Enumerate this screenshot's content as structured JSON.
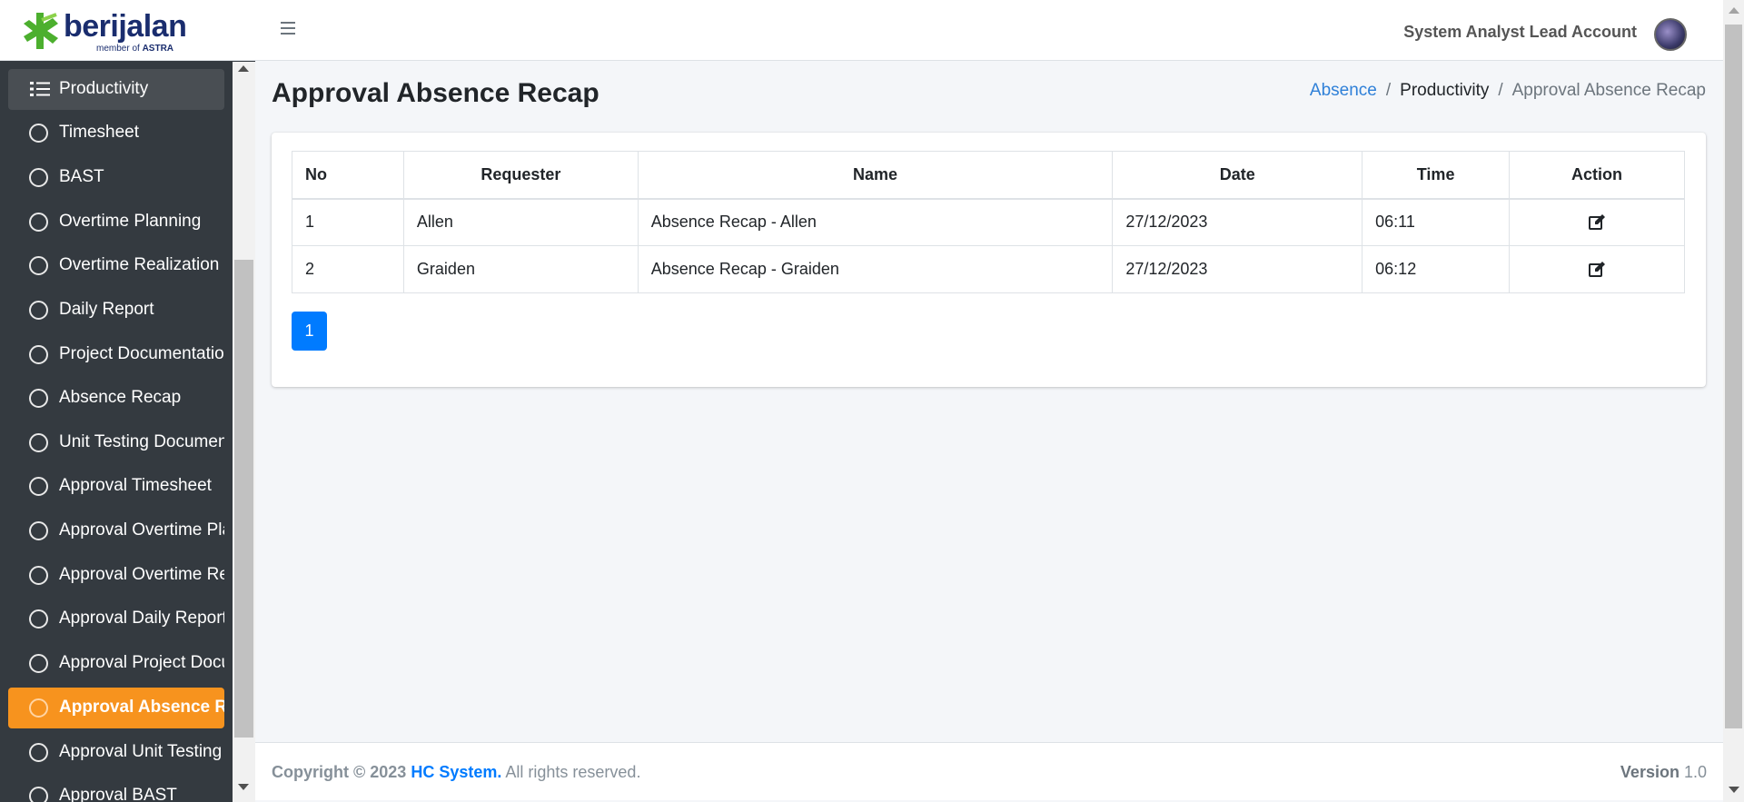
{
  "brand": {
    "name": "berijalan",
    "tagline_prefix": "member of",
    "tagline_bold": "ASTRA"
  },
  "sidebar": {
    "header_item": {
      "label": "Productivity",
      "icon": "list-icon"
    },
    "items": [
      {
        "label": "Timesheet"
      },
      {
        "label": "BAST"
      },
      {
        "label": "Overtime Planning"
      },
      {
        "label": "Overtime Realization"
      },
      {
        "label": "Daily Report"
      },
      {
        "label": "Project Documentation"
      },
      {
        "label": "Absence Recap"
      },
      {
        "label": "Unit Testing Document"
      },
      {
        "label": "Approval Timesheet"
      },
      {
        "label": "Approval Overtime Planning"
      },
      {
        "label": "Approval Overtime Realization"
      },
      {
        "label": "Approval Daily Report"
      },
      {
        "label": "Approval Project Documentation"
      },
      {
        "label": "Approval Absence Recap",
        "active": true
      },
      {
        "label": "Approval Unit Testing Document"
      },
      {
        "label": "Approval BAST"
      }
    ],
    "active_color": "#f7931e"
  },
  "topbar": {
    "user_name": "System Analyst Lead Account"
  },
  "page": {
    "title": "Approval Absence Recap",
    "breadcrumb": {
      "first": "Absence",
      "second": "Productivity",
      "third": "Approval Absence Recap"
    }
  },
  "table": {
    "headers": {
      "no": "No",
      "requester": "Requester",
      "name": "Name",
      "date": "Date",
      "time": "Time",
      "action": "Action"
    },
    "rows": [
      {
        "no": "1",
        "requester": "Allen",
        "name": "Absence Recap - Allen",
        "date": "27/12/2023",
        "time": "06:11",
        "action_icon": "edit-icon"
      },
      {
        "no": "2",
        "requester": "Graiden",
        "name": "Absence Recap - Graiden",
        "date": "27/12/2023",
        "time": "06:12",
        "action_icon": "edit-icon"
      }
    ]
  },
  "pagination": {
    "current": "1"
  },
  "footer": {
    "copyright": "Copyright © 2023",
    "company": "HC System.",
    "rights": "All rights reserved.",
    "version_label": "Version",
    "version_value": "1.0"
  }
}
